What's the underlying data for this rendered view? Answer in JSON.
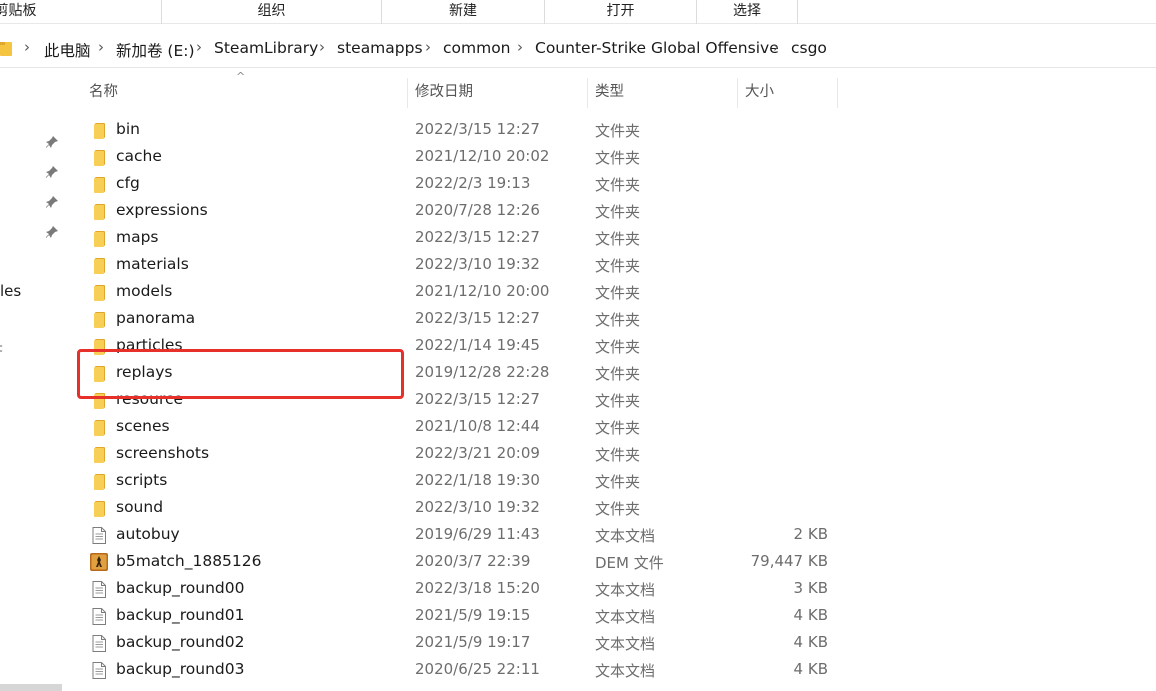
{
  "ribbon": {
    "groups": [
      "剪贴板",
      "组织",
      "新建",
      "打开",
      "选择"
    ]
  },
  "address": {
    "crumbs": [
      "此电脑",
      "新加卷 (E:)",
      "SteamLibrary",
      "steamapps",
      "common",
      "Counter-Strike Global Offensive",
      "csgo"
    ],
    "separator": "›"
  },
  "nav": {
    "partial_label": "les",
    "partial_glyph": "‡"
  },
  "columns": {
    "name": "名称",
    "date": "修改日期",
    "type": "类型",
    "size": "大小",
    "sort_indicator": "^"
  },
  "files": [
    {
      "name": "bin",
      "date": "2022/3/15 12:27",
      "type": "文件夹",
      "size": "",
      "icon": "folder-icon"
    },
    {
      "name": "cache",
      "date": "2021/12/10 20:02",
      "type": "文件夹",
      "size": "",
      "icon": "folder-icon"
    },
    {
      "name": "cfg",
      "date": "2022/2/3 19:13",
      "type": "文件夹",
      "size": "",
      "icon": "folder-icon"
    },
    {
      "name": "expressions",
      "date": "2020/7/28 12:26",
      "type": "文件夹",
      "size": "",
      "icon": "folder-icon"
    },
    {
      "name": "maps",
      "date": "2022/3/15 12:27",
      "type": "文件夹",
      "size": "",
      "icon": "folder-icon"
    },
    {
      "name": "materials",
      "date": "2022/3/10 19:32",
      "type": "文件夹",
      "size": "",
      "icon": "folder-icon"
    },
    {
      "name": "models",
      "date": "2021/12/10 20:00",
      "type": "文件夹",
      "size": "",
      "icon": "folder-icon"
    },
    {
      "name": "panorama",
      "date": "2022/3/15 12:27",
      "type": "文件夹",
      "size": "",
      "icon": "folder-icon"
    },
    {
      "name": "particles",
      "date": "2022/1/14 19:45",
      "type": "文件夹",
      "size": "",
      "icon": "folder-icon"
    },
    {
      "name": "replays",
      "date": "2019/12/28 22:28",
      "type": "文件夹",
      "size": "",
      "icon": "folder-icon"
    },
    {
      "name": "resource",
      "date": "2022/3/15 12:27",
      "type": "文件夹",
      "size": "",
      "icon": "folder-icon"
    },
    {
      "name": "scenes",
      "date": "2021/10/8 12:44",
      "type": "文件夹",
      "size": "",
      "icon": "folder-icon"
    },
    {
      "name": "screenshots",
      "date": "2022/3/21 20:09",
      "type": "文件夹",
      "size": "",
      "icon": "folder-icon"
    },
    {
      "name": "scripts",
      "date": "2022/1/18 19:30",
      "type": "文件夹",
      "size": "",
      "icon": "folder-icon"
    },
    {
      "name": "sound",
      "date": "2022/3/10 19:32",
      "type": "文件夹",
      "size": "",
      "icon": "folder-icon"
    },
    {
      "name": "autobuy",
      "date": "2019/6/29 11:43",
      "type": "文本文档",
      "size": "2 KB",
      "icon": "text-file-icon"
    },
    {
      "name": "b5match_1885126",
      "date": "2020/3/7 22:39",
      "type": "DEM 文件",
      "size": "79,447 KB",
      "icon": "csgo-demo-icon"
    },
    {
      "name": "backup_round00",
      "date": "2022/3/18 15:20",
      "type": "文本文档",
      "size": "3 KB",
      "icon": "text-file-icon"
    },
    {
      "name": "backup_round01",
      "date": "2021/5/9 19:15",
      "type": "文本文档",
      "size": "4 KB",
      "icon": "text-file-icon"
    },
    {
      "name": "backup_round02",
      "date": "2021/5/9 19:17",
      "type": "文本文档",
      "size": "4 KB",
      "icon": "text-file-icon"
    },
    {
      "name": "backup_round03",
      "date": "2020/6/25 22:11",
      "type": "文本文档",
      "size": "4 KB",
      "icon": "text-file-icon"
    }
  ],
  "colors": {
    "highlight": "#e8302a",
    "folder": "#f5c542",
    "muted_text": "#6d6d6d"
  }
}
